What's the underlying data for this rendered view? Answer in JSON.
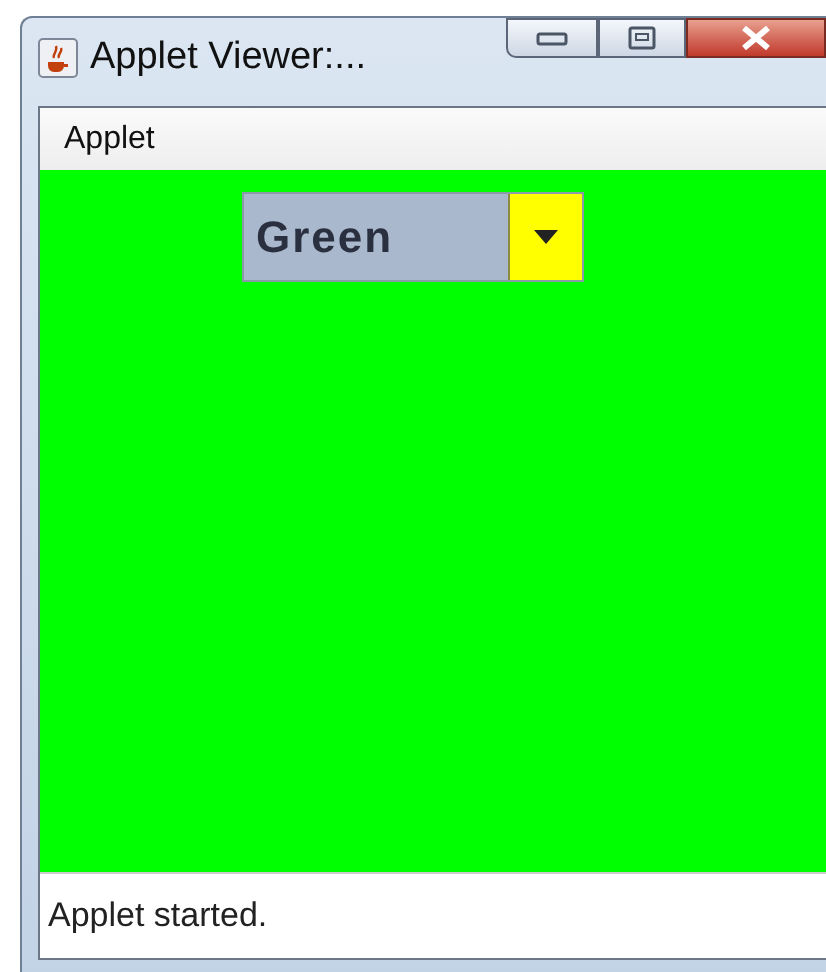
{
  "window": {
    "title": "Applet Viewer:..."
  },
  "menu_bar": {
    "items": [
      "Applet"
    ]
  },
  "combo_box": {
    "value": "Green"
  },
  "status_bar": "Applet started."
}
